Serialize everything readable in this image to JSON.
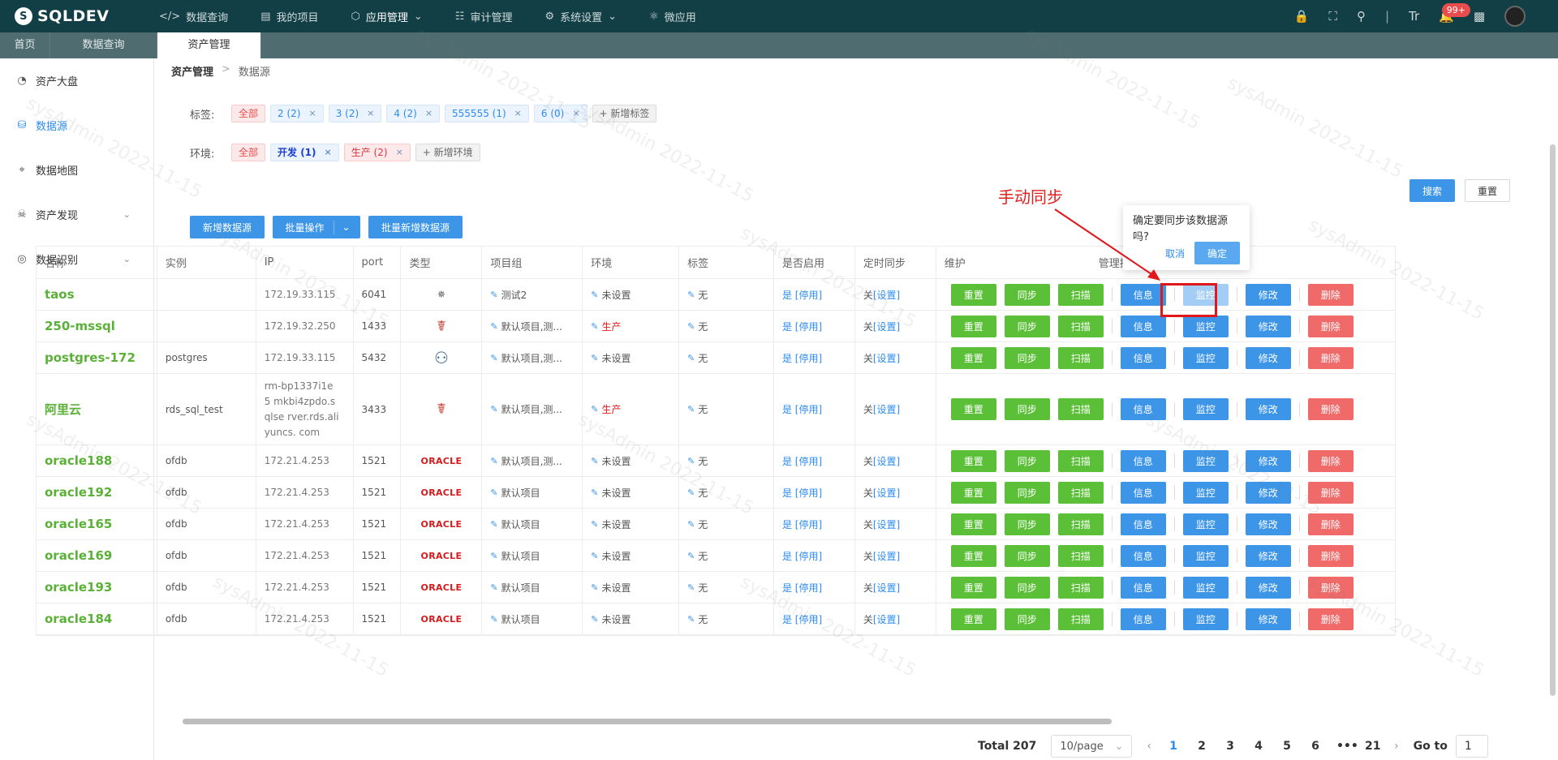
{
  "app": {
    "logo": "SQLDEV"
  },
  "topnav": [
    {
      "icon": "code-icon",
      "label": "数据查询"
    },
    {
      "icon": "folder-icon",
      "label": "我的项目"
    },
    {
      "icon": "cube-icon",
      "label": "应用管理",
      "dropdown": true,
      "active": true
    },
    {
      "icon": "audit-icon",
      "label": "审计管理"
    },
    {
      "icon": "gear-icon",
      "label": "系统设置",
      "dropdown": true
    },
    {
      "icon": "atom-icon",
      "label": "微应用"
    }
  ],
  "topright": {
    "badge": "99+",
    "text_size_label": "Tr"
  },
  "tabs": [
    "首页",
    "数据查询",
    "资产管理"
  ],
  "sidebar": [
    {
      "icon": "pie-icon",
      "label": "资产大盘"
    },
    {
      "icon": "database-icon",
      "label": "数据源",
      "active": true
    },
    {
      "icon": "map-icon",
      "label": "数据地图"
    },
    {
      "icon": "discover-icon",
      "label": "资产发现",
      "expand": true
    },
    {
      "icon": "recognize-icon",
      "label": "数据识别",
      "expand": true
    }
  ],
  "breadcrumb": {
    "root": "资产管理",
    "current": "数据源"
  },
  "filters": {
    "tags_label": "标签:",
    "tags": [
      "全部",
      "2 (2)",
      "3 (2)",
      "4 (2)",
      "555555 (1)",
      "6 (0)"
    ],
    "tags_add": "+ 新增标签",
    "env_label": "环境:",
    "envs": [
      "全部",
      "开发 (1)",
      "生产 (2)"
    ],
    "env_add": "+ 新增环境"
  },
  "toolbar": {
    "search": "搜索",
    "reset": "重置",
    "add": "新增数据源",
    "batch": "批量操作",
    "batch_add": "批量新增数据源"
  },
  "annotation": "手动同步",
  "popover": {
    "question": "确定要同步该数据源吗?",
    "cancel": "取消",
    "confirm": "确定"
  },
  "columns": [
    "名称",
    "实例",
    "IP",
    "port",
    "类型",
    "项目组",
    "环境",
    "标签",
    "是否启用",
    "定时同步",
    "维护",
    "管理操作"
  ],
  "row_buttons": {
    "reset": "重置",
    "sync": "同步",
    "scan": "扫描",
    "info": "信息",
    "monitor": "监控",
    "modify": "修改",
    "delete": "删除"
  },
  "rows": [
    {
      "name": "taos",
      "instance": "",
      "ip": "172.19.33.115",
      "port": "6041",
      "type": "taos",
      "project": "测试2",
      "env": "未设置",
      "env_prod": false,
      "tag": "无",
      "enabled": "是",
      "enabled_link": "[停用]",
      "sync": "关",
      "sync_link": "[设置]",
      "m": "",
      "monitor_dim": true
    },
    {
      "name": "250-mssql",
      "instance": "",
      "ip": "172.19.32.250",
      "port": "1433",
      "type": "mssql",
      "project": "默认项目,测...",
      "env": "生产",
      "env_prod": true,
      "tag": "无",
      "enabled": "是",
      "enabled_link": "[停用]",
      "sync": "关",
      "sync_link": "[设置]",
      "m": "关",
      "monitor_dim": false
    },
    {
      "name": "postgres-172",
      "instance": "postgres",
      "ip": "172.19.33.115",
      "port": "5432",
      "type": "postgres",
      "project": "默认项目,测...",
      "env": "未设置",
      "env_prod": false,
      "tag": "无",
      "enabled": "是",
      "enabled_link": "[停用]",
      "sync": "关",
      "sync_link": "[设置]",
      "m": "关",
      "monitor_dim": false
    },
    {
      "name": "阿里云",
      "instance": "rds_sql_test",
      "ip": "rm-bp1337i1e5 mkbi4zpdo.sqlse rver.rds.aliyuncs. com",
      "port": "3433",
      "type": "mssql",
      "project": "默认项目,测...",
      "env": "生产",
      "env_prod": true,
      "tag": "无",
      "enabled": "是",
      "enabled_link": "[停用]",
      "sync": "关",
      "sync_link": "[设置]",
      "m": "关",
      "monitor_dim": false
    },
    {
      "name": "oracle188",
      "instance": "ofdb",
      "ip": "172.21.4.253",
      "port": "1521",
      "type": "ORACLE",
      "project": "默认项目,测...",
      "env": "未设置",
      "env_prod": false,
      "tag": "无",
      "enabled": "是",
      "enabled_link": "[停用]",
      "sync": "关",
      "sync_link": "[设置]",
      "m": "关",
      "monitor_dim": false
    },
    {
      "name": "oracle192",
      "instance": "ofdb",
      "ip": "172.21.4.253",
      "port": "1521",
      "type": "ORACLE",
      "project": "默认项目",
      "env": "未设置",
      "env_prod": false,
      "tag": "无",
      "enabled": "是",
      "enabled_link": "[停用]",
      "sync": "关",
      "sync_link": "[设置]",
      "m": "关",
      "monitor_dim": false
    },
    {
      "name": "oracle165",
      "instance": "ofdb",
      "ip": "172.21.4.253",
      "port": "1521",
      "type": "ORACLE",
      "project": "默认项目",
      "env": "未设置",
      "env_prod": false,
      "tag": "无",
      "enabled": "是",
      "enabled_link": "[停用]",
      "sync": "关",
      "sync_link": "[设置]",
      "m": "关",
      "monitor_dim": false
    },
    {
      "name": "oracle169",
      "instance": "ofdb",
      "ip": "172.21.4.253",
      "port": "1521",
      "type": "ORACLE",
      "project": "默认项目",
      "env": "未设置",
      "env_prod": false,
      "tag": "无",
      "enabled": "是",
      "enabled_link": "[停用]",
      "sync": "关",
      "sync_link": "[设置]",
      "m": "关",
      "monitor_dim": false
    },
    {
      "name": "oracle193",
      "instance": "ofdb",
      "ip": "172.21.4.253",
      "port": "1521",
      "type": "ORACLE",
      "project": "默认项目",
      "env": "未设置",
      "env_prod": false,
      "tag": "无",
      "enabled": "是",
      "enabled_link": "[停用]",
      "sync": "关",
      "sync_link": "[设置]",
      "m": "关",
      "monitor_dim": false
    },
    {
      "name": "oracle184",
      "instance": "ofdb",
      "ip": "172.21.4.253",
      "port": "1521",
      "type": "ORACLE",
      "project": "默认项目",
      "env": "未设置",
      "env_prod": false,
      "tag": "无",
      "enabled": "是",
      "enabled_link": "[停用]",
      "sync": "关",
      "sync_link": "[设置]",
      "m": "关",
      "monitor_dim": false
    }
  ],
  "pagination": {
    "total": "Total 207",
    "page_size": "10/page",
    "pages": [
      "1",
      "2",
      "3",
      "4",
      "5",
      "6",
      "•••",
      "21"
    ],
    "current": "1",
    "goto_label": "Go to",
    "goto_value": "1"
  },
  "watermark": "sysAdmin 2022-11-15",
  "colors": {
    "topbar": "#123f45",
    "accent": "#2d8cf0",
    "green": "#5bc038",
    "red": "#f06a6a"
  }
}
